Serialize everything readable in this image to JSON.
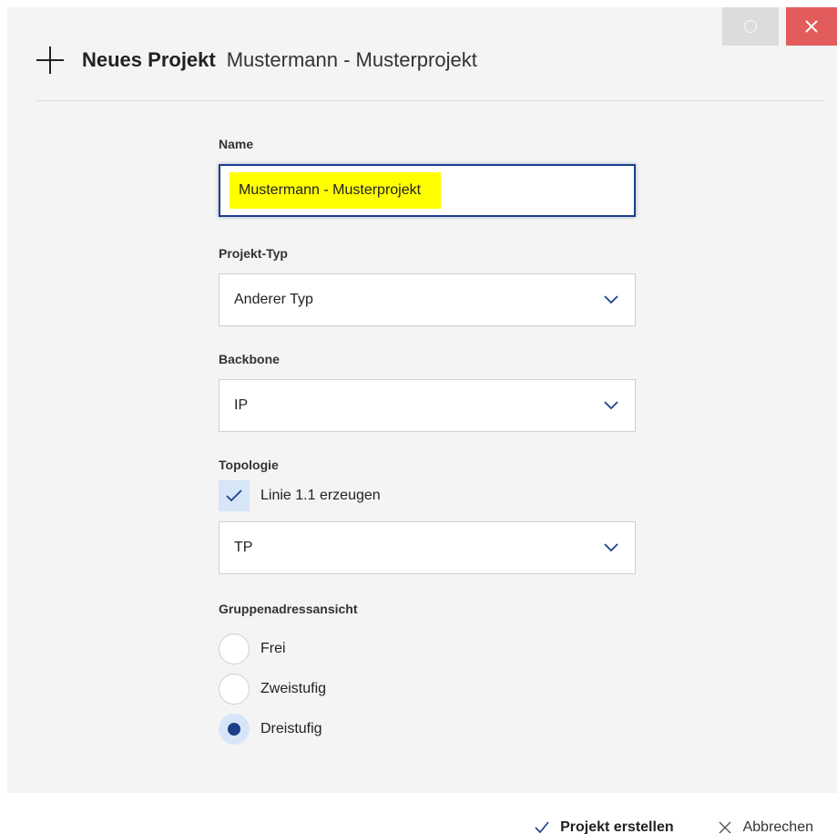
{
  "window": {
    "maximize_icon": "circle-icon",
    "close_icon": "close-icon"
  },
  "header": {
    "icon": "plus-icon",
    "title": "Neues Projekt",
    "project_name": "Mustermann - Musterprojekt"
  },
  "form": {
    "name": {
      "label": "Name",
      "value": "Mustermann - Musterprojekt"
    },
    "project_type": {
      "label": "Projekt-Typ",
      "value": "Anderer Typ"
    },
    "backbone": {
      "label": "Backbone",
      "value": "IP"
    },
    "topology": {
      "label": "Topologie",
      "checkbox_label": "Linie 1.1 erzeugen",
      "checked": true,
      "value": "TP"
    },
    "group_address_view": {
      "label": "Gruppenadressansicht",
      "options": [
        {
          "label": "Frei",
          "selected": false
        },
        {
          "label": "Zweistufig",
          "selected": false
        },
        {
          "label": "Dreistufig",
          "selected": true
        }
      ]
    }
  },
  "footer": {
    "create_label": "Projekt erstellen",
    "cancel_label": "Abbrechen"
  },
  "colors": {
    "accent": "#1d3f8a",
    "highlight": "#ffff00",
    "close": "#e25c5c",
    "selection_bg": "#d6e6f8"
  }
}
